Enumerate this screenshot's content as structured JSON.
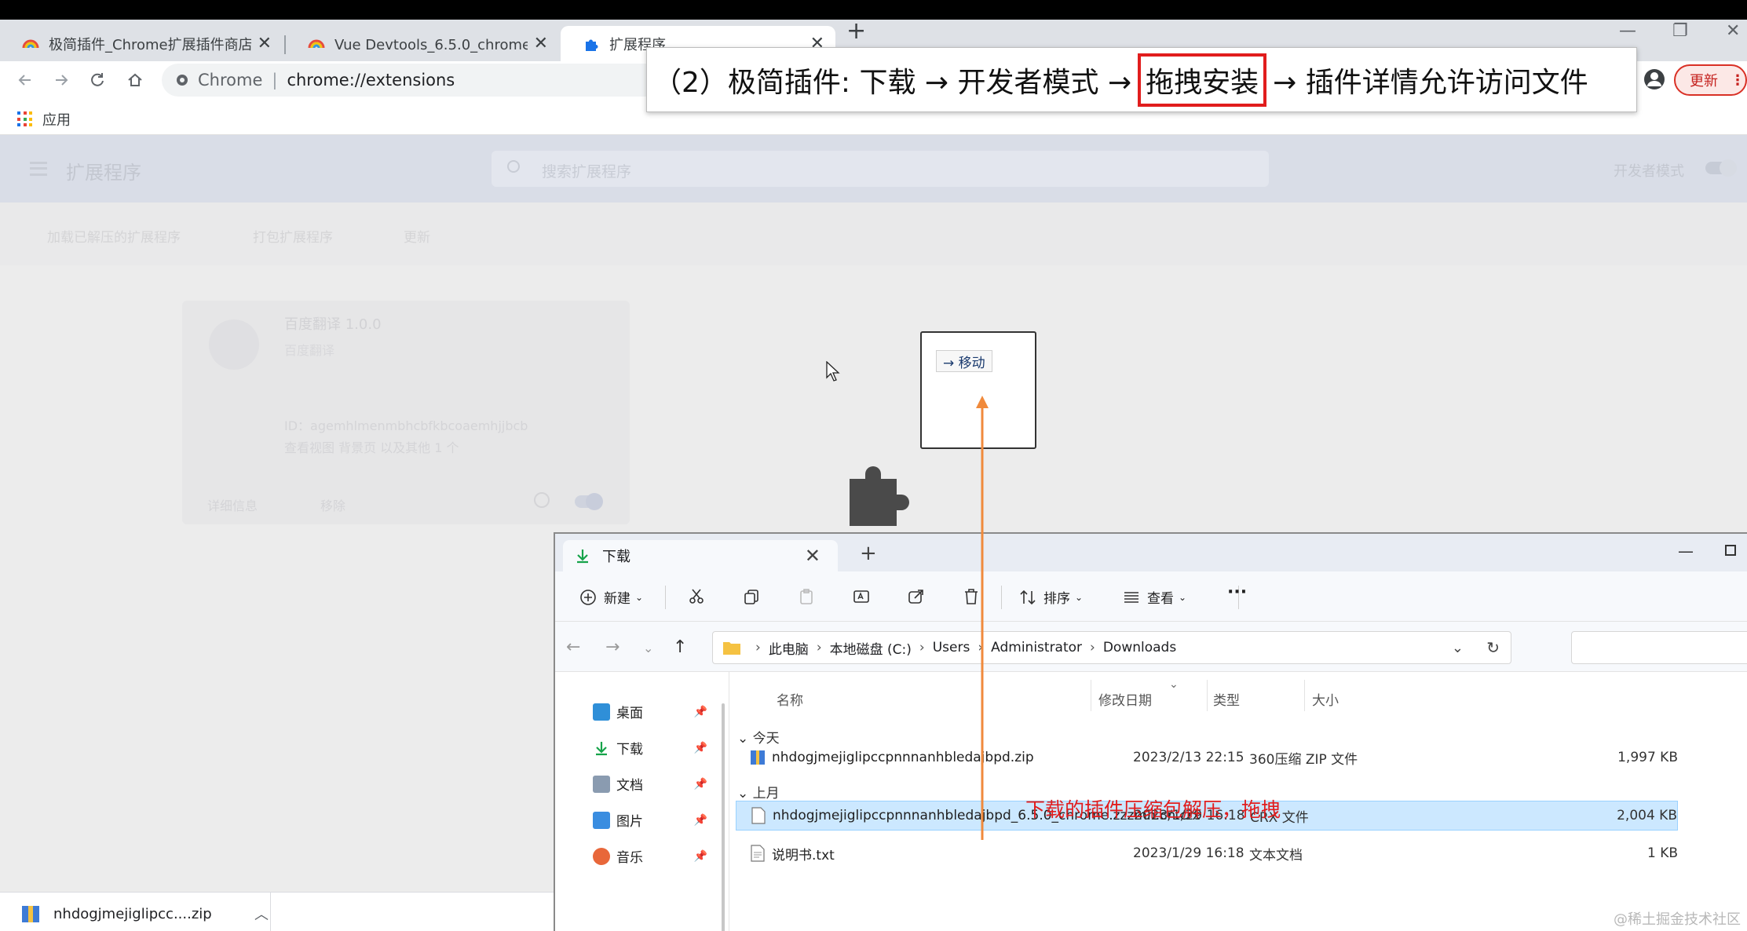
{
  "browser": {
    "tabs": [
      {
        "title": "极简插件_Chrome扩展插件商店"
      },
      {
        "title": "Vue Devtools_6.5.0_chrome扩展"
      },
      {
        "title": "扩展程序"
      }
    ],
    "omnibox": {
      "scheme_label": "Chrome",
      "url": "chrome://extensions"
    },
    "update_label": "更新",
    "bookmarks": {
      "apps_label": "应用"
    }
  },
  "banner": {
    "prefix": "（2）极简插件: 下载 → 开发者模式 →",
    "highlight": "拖拽安装",
    "suffix": "→ 插件详情允许访问文件"
  },
  "extensions_page": {
    "title": "扩展程序",
    "search_placeholder": "搜索扩展程序",
    "dev_mode_label": "开发者模式",
    "subnav": [
      "加载已解压的扩展程序",
      "打包扩展程序",
      "更新"
    ],
    "card": {
      "name": "百度翻译  1.0.0",
      "desc": "百度翻译",
      "id_line": "ID：agemhlmenmbhcbfkbcoaemhjjbcb",
      "inspect_line": "查看视图 背景页 以及其他 1 个",
      "details_btn": "详细信息",
      "remove_btn": "移除"
    }
  },
  "drag": {
    "tooltip": "→ 移动"
  },
  "explorer": {
    "tab_title": "下载",
    "commands": {
      "new": "新建",
      "sort": "排序",
      "view": "查看",
      "more": "···"
    },
    "breadcrumb": [
      "此电脑",
      "本地磁盘 (C:)",
      "Users",
      "Administrator",
      "Downloads"
    ],
    "nav_items": [
      {
        "label": "桌面"
      },
      {
        "label": "下载"
      },
      {
        "label": "文档"
      },
      {
        "label": "图片"
      },
      {
        "label": "音乐"
      }
    ],
    "columns": {
      "name": "名称",
      "date": "修改日期",
      "type": "类型",
      "size": "大小"
    },
    "groups": {
      "today": "今天",
      "last_month": "上月"
    },
    "files": [
      {
        "name": "nhdogjmejiglipccpnnnanhbledajbpd.zip",
        "date": "2023/2/13 22:15",
        "type": "360压缩 ZIP 文件",
        "size": "1,997 KB"
      },
      {
        "name": "nhdogjmejiglipccpnnnanhbledajbpd_6.5.0_chrome.zzzmh.cn.crx",
        "date": "2023/1/29 16:18",
        "type": "CRX 文件",
        "size": "2,004 KB"
      },
      {
        "name": "说明书.txt",
        "date": "2023/1/29 16:18",
        "type": "文本文档",
        "size": "1 KB"
      }
    ]
  },
  "annotation": {
    "red_note": "下载的插件压缩包解压，拖拽"
  },
  "download_bar": {
    "item": "nhdogjmejiglipcc....zip"
  },
  "watermark": "@稀土掘金技术社区",
  "colors": {
    "accent_red": "#e11d1d",
    "arrow_orange": "#f08a3c",
    "selection": "#cce8ff"
  }
}
